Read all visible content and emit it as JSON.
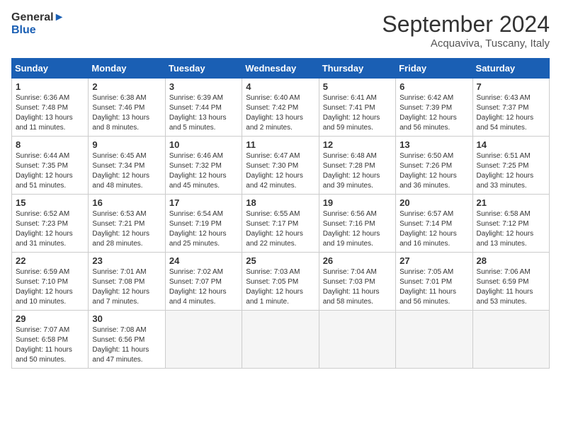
{
  "header": {
    "logo_line1": "General",
    "logo_line2": "Blue",
    "month": "September 2024",
    "location": "Acquaviva, Tuscany, Italy"
  },
  "days_of_week": [
    "Sunday",
    "Monday",
    "Tuesday",
    "Wednesday",
    "Thursday",
    "Friday",
    "Saturday"
  ],
  "weeks": [
    [
      {
        "day": "1",
        "sunrise": "6:36 AM",
        "sunset": "7:48 PM",
        "daylight": "13 hours and 11 minutes."
      },
      {
        "day": "2",
        "sunrise": "6:38 AM",
        "sunset": "7:46 PM",
        "daylight": "13 hours and 8 minutes."
      },
      {
        "day": "3",
        "sunrise": "6:39 AM",
        "sunset": "7:44 PM",
        "daylight": "13 hours and 5 minutes."
      },
      {
        "day": "4",
        "sunrise": "6:40 AM",
        "sunset": "7:42 PM",
        "daylight": "13 hours and 2 minutes."
      },
      {
        "day": "5",
        "sunrise": "6:41 AM",
        "sunset": "7:41 PM",
        "daylight": "12 hours and 59 minutes."
      },
      {
        "day": "6",
        "sunrise": "6:42 AM",
        "sunset": "7:39 PM",
        "daylight": "12 hours and 56 minutes."
      },
      {
        "day": "7",
        "sunrise": "6:43 AM",
        "sunset": "7:37 PM",
        "daylight": "12 hours and 54 minutes."
      }
    ],
    [
      {
        "day": "8",
        "sunrise": "6:44 AM",
        "sunset": "7:35 PM",
        "daylight": "12 hours and 51 minutes."
      },
      {
        "day": "9",
        "sunrise": "6:45 AM",
        "sunset": "7:34 PM",
        "daylight": "12 hours and 48 minutes."
      },
      {
        "day": "10",
        "sunrise": "6:46 AM",
        "sunset": "7:32 PM",
        "daylight": "12 hours and 45 minutes."
      },
      {
        "day": "11",
        "sunrise": "6:47 AM",
        "sunset": "7:30 PM",
        "daylight": "12 hours and 42 minutes."
      },
      {
        "day": "12",
        "sunrise": "6:48 AM",
        "sunset": "7:28 PM",
        "daylight": "12 hours and 39 minutes."
      },
      {
        "day": "13",
        "sunrise": "6:50 AM",
        "sunset": "7:26 PM",
        "daylight": "12 hours and 36 minutes."
      },
      {
        "day": "14",
        "sunrise": "6:51 AM",
        "sunset": "7:25 PM",
        "daylight": "12 hours and 33 minutes."
      }
    ],
    [
      {
        "day": "15",
        "sunrise": "6:52 AM",
        "sunset": "7:23 PM",
        "daylight": "12 hours and 31 minutes."
      },
      {
        "day": "16",
        "sunrise": "6:53 AM",
        "sunset": "7:21 PM",
        "daylight": "12 hours and 28 minutes."
      },
      {
        "day": "17",
        "sunrise": "6:54 AM",
        "sunset": "7:19 PM",
        "daylight": "12 hours and 25 minutes."
      },
      {
        "day": "18",
        "sunrise": "6:55 AM",
        "sunset": "7:17 PM",
        "daylight": "12 hours and 22 minutes."
      },
      {
        "day": "19",
        "sunrise": "6:56 AM",
        "sunset": "7:16 PM",
        "daylight": "12 hours and 19 minutes."
      },
      {
        "day": "20",
        "sunrise": "6:57 AM",
        "sunset": "7:14 PM",
        "daylight": "12 hours and 16 minutes."
      },
      {
        "day": "21",
        "sunrise": "6:58 AM",
        "sunset": "7:12 PM",
        "daylight": "12 hours and 13 minutes."
      }
    ],
    [
      {
        "day": "22",
        "sunrise": "6:59 AM",
        "sunset": "7:10 PM",
        "daylight": "12 hours and 10 minutes."
      },
      {
        "day": "23",
        "sunrise": "7:01 AM",
        "sunset": "7:08 PM",
        "daylight": "12 hours and 7 minutes."
      },
      {
        "day": "24",
        "sunrise": "7:02 AM",
        "sunset": "7:07 PM",
        "daylight": "12 hours and 4 minutes."
      },
      {
        "day": "25",
        "sunrise": "7:03 AM",
        "sunset": "7:05 PM",
        "daylight": "12 hours and 1 minute."
      },
      {
        "day": "26",
        "sunrise": "7:04 AM",
        "sunset": "7:03 PM",
        "daylight": "11 hours and 58 minutes."
      },
      {
        "day": "27",
        "sunrise": "7:05 AM",
        "sunset": "7:01 PM",
        "daylight": "11 hours and 56 minutes."
      },
      {
        "day": "28",
        "sunrise": "7:06 AM",
        "sunset": "6:59 PM",
        "daylight": "11 hours and 53 minutes."
      }
    ],
    [
      {
        "day": "29",
        "sunrise": "7:07 AM",
        "sunset": "6:58 PM",
        "daylight": "11 hours and 50 minutes."
      },
      {
        "day": "30",
        "sunrise": "7:08 AM",
        "sunset": "6:56 PM",
        "daylight": "11 hours and 47 minutes."
      },
      null,
      null,
      null,
      null,
      null
    ]
  ]
}
